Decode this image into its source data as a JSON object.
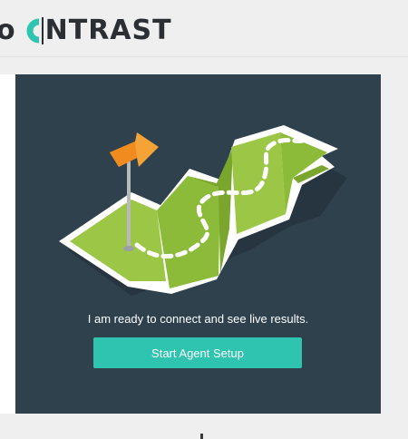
{
  "header": {
    "logo_prefix": "o",
    "logo_text": "NTRAST",
    "logo_accent_color": "#2ec4b0"
  },
  "card": {
    "message": "I am ready to connect and see live results.",
    "button_label": "Start Agent Setup",
    "background_color": "#2f414c"
  },
  "icons": {
    "illustration": "folded-map-with-flag-icon",
    "logo_mark": "contrast-c-icon"
  }
}
